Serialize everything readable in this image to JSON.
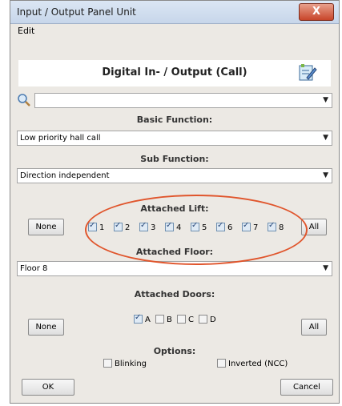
{
  "window": {
    "title": "Input / Output Panel Unit",
    "close_label": "X"
  },
  "menu": {
    "edit": "Edit"
  },
  "header": {
    "title": "Digital In- / Output (Call)"
  },
  "search": {
    "value": ""
  },
  "basic_function": {
    "label": "Basic Function:",
    "value": "Low priority hall call"
  },
  "sub_function": {
    "label": "Sub Function:",
    "value": "Direction independent"
  },
  "attached_lift": {
    "label": "Attached Lift:",
    "none_button": "None",
    "all_button": "All",
    "items": [
      {
        "label": "1",
        "checked": true
      },
      {
        "label": "2",
        "checked": true
      },
      {
        "label": "3",
        "checked": true
      },
      {
        "label": "4",
        "checked": true
      },
      {
        "label": "5",
        "checked": true
      },
      {
        "label": "6",
        "checked": true
      },
      {
        "label": "7",
        "checked": true
      },
      {
        "label": "8",
        "checked": true
      }
    ]
  },
  "attached_floor": {
    "label": "Attached Floor:",
    "value": "Floor 8"
  },
  "attached_doors": {
    "label": "Attached Doors:",
    "none_button": "None",
    "all_button": "All",
    "items": [
      {
        "label": "A",
        "checked": true
      },
      {
        "label": "B",
        "checked": false
      },
      {
        "label": "C",
        "checked": false
      },
      {
        "label": "D",
        "checked": false
      }
    ]
  },
  "options": {
    "label": "Options:",
    "blinking": "Blinking",
    "inverted": "Inverted (NCC)"
  },
  "footer": {
    "ok": "OK",
    "cancel": "Cancel"
  },
  "colors": {
    "highlight_ellipse": "#e0552c",
    "titlebar": "#c7d6ea",
    "dialog_bg": "#ece9e4"
  }
}
